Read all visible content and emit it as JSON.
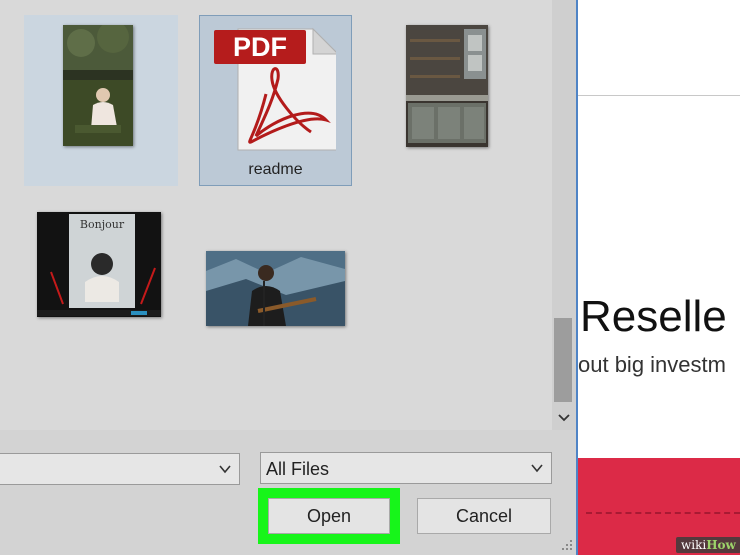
{
  "webpage": {
    "heading": "Reselle",
    "subtext": "out big investm"
  },
  "dialog": {
    "files": [
      {
        "name": "",
        "thumbnail": "photo-baby-in-grass",
        "state": "hover"
      },
      {
        "name": "readme",
        "thumbnail": "pdf-icon",
        "state": "selected",
        "badge": "PDF"
      },
      {
        "name": "",
        "thumbnail": "photo-kitchen-shelves",
        "state": "normal"
      },
      {
        "name": "",
        "thumbnail": "screenshot-bonjour",
        "state": "normal",
        "thumb_title": "Bonjour"
      },
      {
        "name": "",
        "thumbnail": "photo-singer-guitar",
        "state": "normal"
      }
    ],
    "file_type": "All Files",
    "open_label": "Open",
    "cancel_label": "Cancel",
    "highlight_color": "#17f51a"
  },
  "watermark": {
    "prefix": "wiki",
    "suffix": "How"
  }
}
